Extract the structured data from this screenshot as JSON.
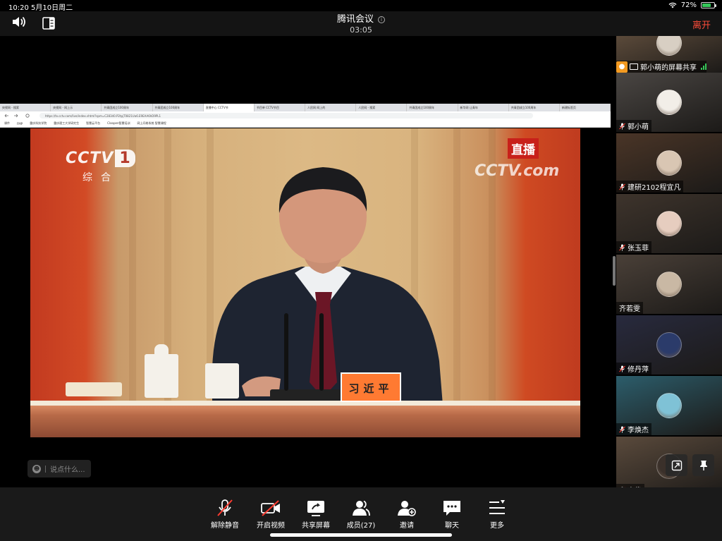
{
  "status_bar": {
    "time_date": "10:20  5月10日周二",
    "battery": "72%",
    "battery_level": 0.72
  },
  "header": {
    "title": "腾讯会议",
    "timer": "03:05",
    "leave_label": "离开"
  },
  "shared_screen": {
    "browser_tabs": [
      "央视网 - 搜索",
      "央视网 - 网上示",
      "共青团成立100周年",
      "共青团成立100周年",
      "直播中心 CCTV节",
      "节目单 CCTV节目",
      "人民网 网上的",
      "人民网 - 搜索",
      "共青团成立100周年",
      "新华网 让青年",
      "共青团成立100周年",
      "新建标签页"
    ],
    "url": "https://tv.cctv.com/live/index.shtml?spm=C28340.P2tpjT0821Ua6.E9EAA6hD9PL1",
    "bookmarks": [
      "课件",
      "FMP",
      "重庆科技学院",
      "重庆理工大学研究生",
      "智慧云平台",
      "Cloopen智慧培训",
      "网上问卷系统 智慧课程"
    ]
  },
  "broadcast": {
    "logo_text": "CCTV",
    "logo_number": "1",
    "channel": "综合",
    "live_badge": "直播",
    "watermark": "CCTV.com",
    "nameplate": "习近平"
  },
  "chat": {
    "placeholder": "说点什么..."
  },
  "participants": [
    {
      "name": "郭小萌的屏幕共享",
      "kind": "share",
      "bg": "#5b4a3a",
      "avatar": "#d8cfc3"
    },
    {
      "name": "郭小萌",
      "kind": "muted",
      "bg": "#4a4643",
      "avatar": "#f2eee8"
    },
    {
      "name": "建研2102程宜凡",
      "kind": "muted",
      "bg": "#4a3527",
      "avatar": "#d9c6b3"
    },
    {
      "name": "张玉菲",
      "kind": "muted",
      "bg": "#3e342c",
      "avatar": "#e6cdbf"
    },
    {
      "name": "齐若雯",
      "kind": "plain",
      "bg": "#4a4038",
      "avatar": "#c9b8a4"
    },
    {
      "name": "修丹萍",
      "kind": "muted",
      "bg": "#282a3e",
      "avatar": "#2b3b6a"
    },
    {
      "name": "李焕杰",
      "kind": "muted",
      "bg": "#2c5d6b",
      "avatar": "#7fc2d6"
    },
    {
      "name": "高俊",
      "kind": "muted",
      "bg": "#5a4a3c",
      "avatar": "#3a302a"
    }
  ],
  "toolbar": [
    {
      "label": "解除静音",
      "icon": "mic-muted-icon"
    },
    {
      "label": "开启视频",
      "icon": "camera-off-icon"
    },
    {
      "label": "共享屏幕",
      "icon": "share-screen-icon"
    },
    {
      "label": "成员(27)",
      "icon": "members-icon"
    },
    {
      "label": "邀请",
      "icon": "invite-icon"
    },
    {
      "label": "聊天",
      "icon": "chat-icon"
    },
    {
      "label": "更多",
      "icon": "more-icon"
    }
  ]
}
